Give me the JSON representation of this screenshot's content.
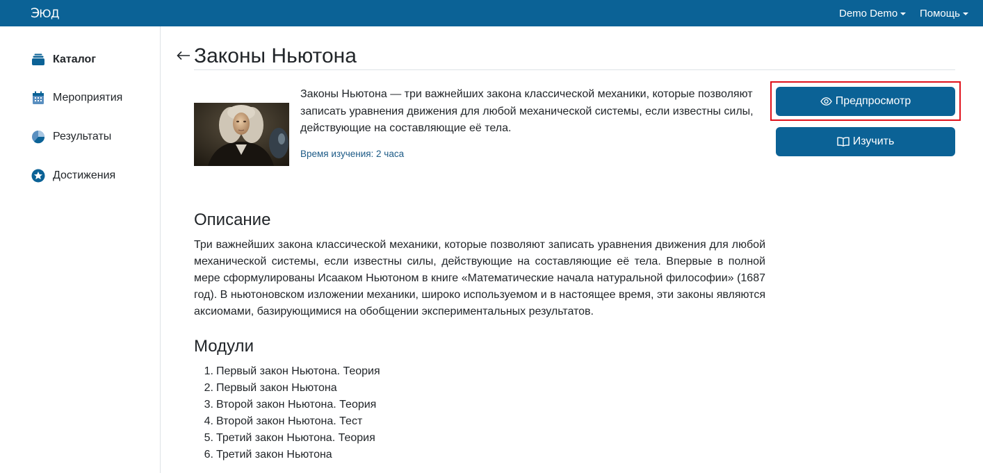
{
  "header": {
    "logo_mark": "Э",
    "logo_text": "ЮД",
    "user_menu": "Demo Demo",
    "help_menu": "Помощь"
  },
  "sidebar": {
    "items": [
      {
        "label": "Каталог",
        "icon": "catalog-icon",
        "active": true
      },
      {
        "label": "Мероприятия",
        "icon": "calendar-icon",
        "active": false
      },
      {
        "label": "Результаты",
        "icon": "pie-chart-icon",
        "active": false
      },
      {
        "label": "Достижения",
        "icon": "star-icon",
        "active": false
      }
    ]
  },
  "course": {
    "back_icon": "arrow-left-icon",
    "title": "Законы Ньютона",
    "image": "newton-portrait",
    "summary": "Законы Ньютона — три важнейших закона классической механики, которые позволяют записать уравнения движения для любой механической системы, если известны силы, действующие на составляющие её тела.",
    "study_time": "Время изучения: 2 часа",
    "preview_button": "Предпросмотр",
    "study_button": "Изучить",
    "description_heading": "Описание",
    "description": "Три важнейших закона классической механики, которые позволяют записать уравнения движения для любой механической системы, если известны силы, действующие на составляющие её тела. Впервые в полной мере сформулированы Исааком Ньютоном в книге «Математические начала натуральной философии» (1687 год). В ньютоновском изложении механики, широко используемом и в настоящее время, эти законы являются аксиомами, базирующимися на обобщении экспериментальных результатов.",
    "modules_heading": "Модули",
    "modules": [
      {
        "num": "1.",
        "title": "Первый закон Ньютона. Теория"
      },
      {
        "num": "2.",
        "title": "Первый закон Ньютона"
      },
      {
        "num": "3.",
        "title": "Второй закон Ньютона. Теория"
      },
      {
        "num": "4.",
        "title": "Второй закон Ньютона. Тест"
      },
      {
        "num": "5.",
        "title": "Третий закон Ньютона. Теория"
      },
      {
        "num": "6.",
        "title": "Третий закон Ньютона"
      }
    ]
  },
  "colors": {
    "brand": "#0b6296",
    "link": "#1c5a86",
    "highlight": "#e0101a"
  }
}
